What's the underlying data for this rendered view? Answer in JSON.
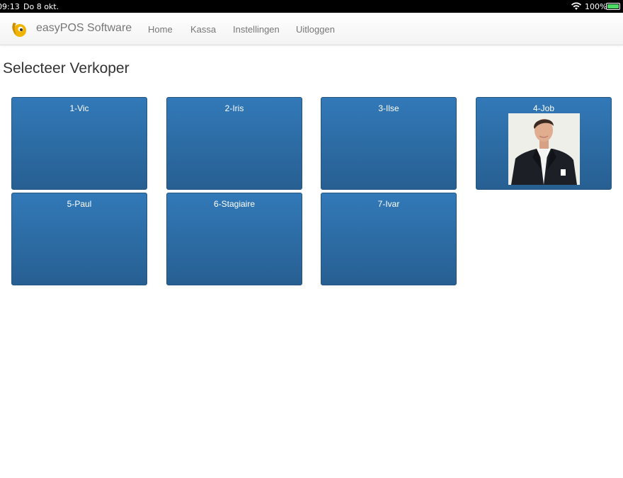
{
  "status_bar": {
    "time": "09:13",
    "date": "Do 8 okt.",
    "battery": "100%",
    "battery_level": 1.0
  },
  "navbar": {
    "brand": "easyPOS Software",
    "logo_icon": "easypos-logo-icon",
    "items": [
      {
        "label": "Home"
      },
      {
        "label": "Kassa"
      },
      {
        "label": "Instellingen"
      },
      {
        "label": "Uitloggen"
      }
    ]
  },
  "page": {
    "title": "Selecteer Verkoper"
  },
  "sellers": [
    {
      "label": "1-Vic"
    },
    {
      "label": "2-Iris"
    },
    {
      "label": "3-Ilse"
    },
    {
      "label": "4-Job",
      "photo": "person-photo"
    },
    {
      "label": "5-Paul"
    },
    {
      "label": "6-Stagiaire"
    },
    {
      "label": "7-Ivar"
    }
  ],
  "colors": {
    "tile_top": "#3279b8",
    "tile_bottom": "#275f92",
    "logo_yellow": "#f0b400",
    "battery_green": "#4cd964"
  }
}
